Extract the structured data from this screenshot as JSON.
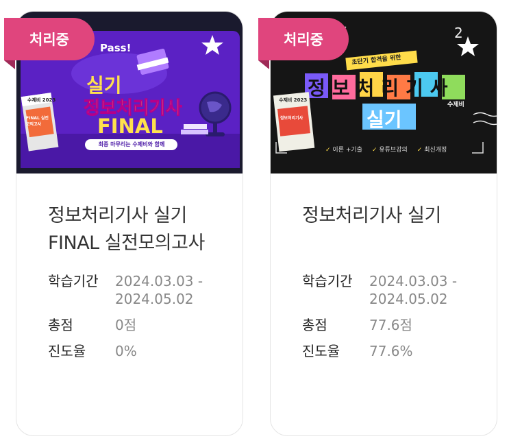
{
  "cards": [
    {
      "badge": "처리중",
      "thumbnail": {
        "top_label": "Pass!",
        "line1": "실기",
        "line2": "정보처리기사",
        "line3": "FINAL",
        "ribbon": "최종 마무리는 수제비와 함께",
        "book_label": "수제비 2023",
        "book_sub": "FINAL 실전 모의고사"
      },
      "title": "정보처리기사 실기 FINAL 실전모의고사",
      "labels": {
        "period": "학습기간",
        "score": "총점",
        "progress": "진도율"
      },
      "period": "2024.03.03 - 2024.05.02",
      "score": "0점",
      "progress": "0%"
    },
    {
      "badge": "처리중",
      "thumbnail": {
        "tagline": "초단기 합격을 위한",
        "line1": "정보처리기사",
        "line2": "실기",
        "author": "수제비",
        "book_label": "수제비 2023",
        "book_sub": "정보처리기사",
        "features": [
          "이론 +기출",
          "유튜브강의",
          "최신개정"
        ]
      },
      "title": "정보처리기사 실기",
      "labels": {
        "period": "학습기간",
        "score": "총점",
        "progress": "진도율"
      },
      "period": "2024.03.03 - 2024.05.02",
      "score": "77.6점",
      "progress": "77.6%"
    }
  ],
  "colors": {
    "badge": "#e0457d",
    "poster1_bg": "#5b21c4",
    "poster2_bg": "#151515",
    "title_text": "#333333",
    "value_text": "#888888"
  },
  "icons": [
    "star-icon",
    "book-icon",
    "globe-icon"
  ]
}
